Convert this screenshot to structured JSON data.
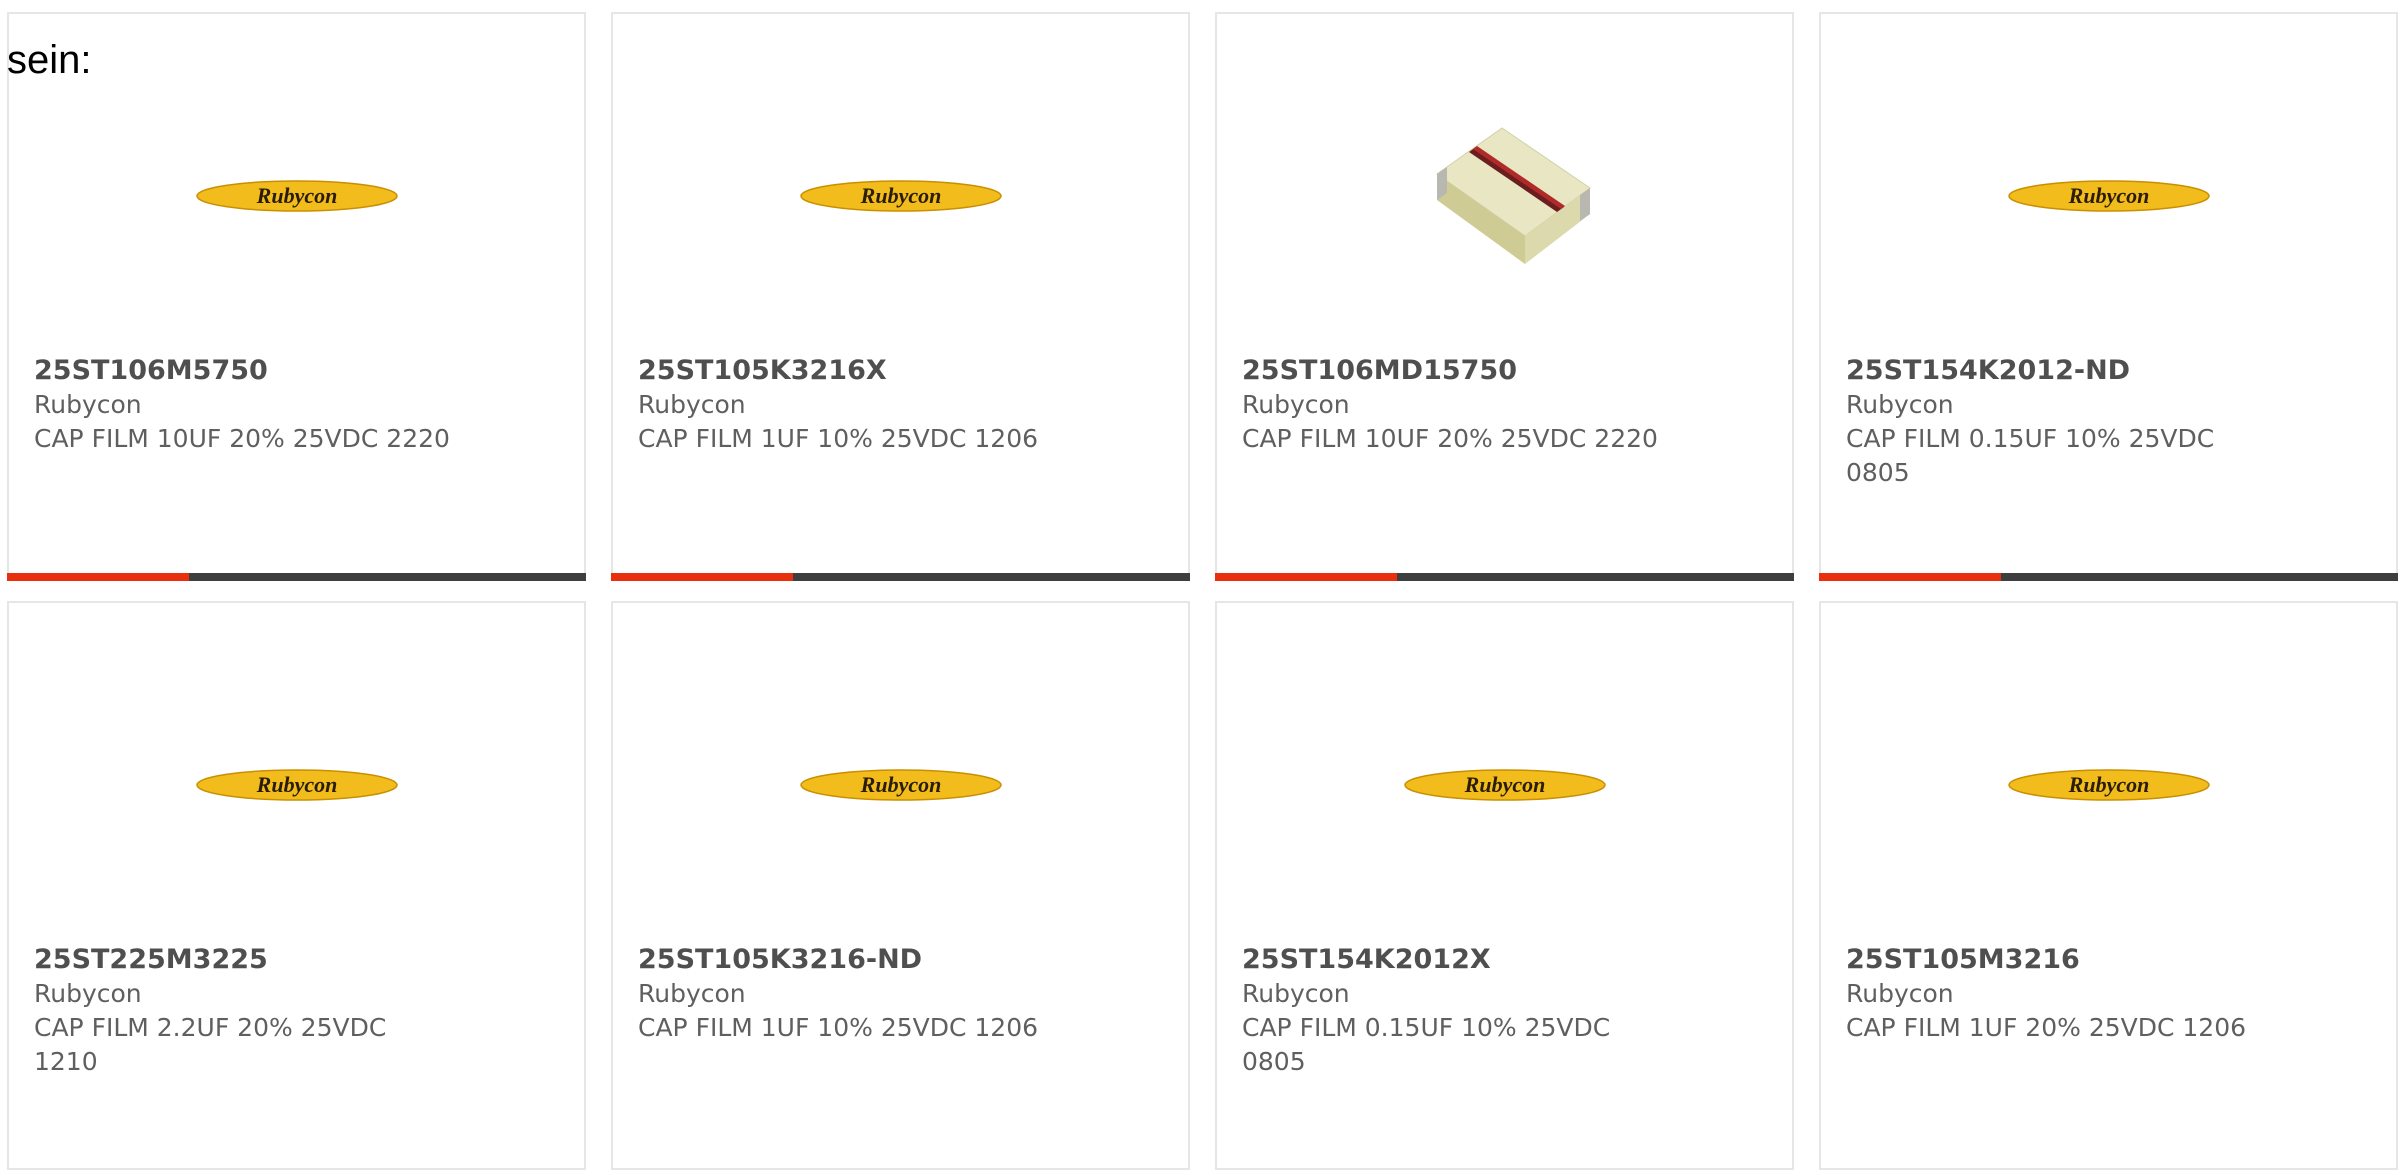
{
  "heading": "sein:",
  "colors": {
    "accent": "#e8300f",
    "bar_dark": "#3e3e3e",
    "logo_yellow": "#f2bd1c"
  },
  "products": [
    {
      "part": "25ST106M5750",
      "brand": "Rubycon",
      "desc": "CAP FILM 10UF 20% 25VDC 2220",
      "image": "rubycon-logo",
      "logo_text": "Rubycon"
    },
    {
      "part": "25ST105K3216X",
      "brand": "Rubycon",
      "desc": "CAP FILM 1UF 10% 25VDC 1206",
      "image": "rubycon-logo",
      "logo_text": "Rubycon"
    },
    {
      "part": "25ST106MD15750",
      "brand": "Rubycon",
      "desc": "CAP FILM 10UF 20% 25VDC 2220",
      "image": "capacitor-photo"
    },
    {
      "part": "25ST154K2012-ND",
      "brand": "Rubycon",
      "desc": "CAP FILM 0.15UF 10% 25VDC 0805",
      "image": "rubycon-logo",
      "logo_text": "Rubycon"
    },
    {
      "part": "25ST225M3225",
      "brand": "Rubycon",
      "desc": "CAP FILM 2.2UF 20% 25VDC 1210",
      "image": "rubycon-logo",
      "logo_text": "Rubycon"
    },
    {
      "part": "25ST105K3216-ND",
      "brand": "Rubycon",
      "desc": "CAP FILM 1UF 10% 25VDC 1206",
      "image": "rubycon-logo",
      "logo_text": "Rubycon"
    },
    {
      "part": "25ST154K2012X",
      "brand": "Rubycon",
      "desc": "CAP FILM 0.15UF 10% 25VDC 0805",
      "image": "rubycon-logo",
      "logo_text": "Rubycon"
    },
    {
      "part": "25ST105M3216",
      "brand": "Rubycon",
      "desc": "CAP FILM 1UF 20% 25VDC 1206",
      "image": "rubycon-logo",
      "logo_text": "Rubycon"
    }
  ]
}
